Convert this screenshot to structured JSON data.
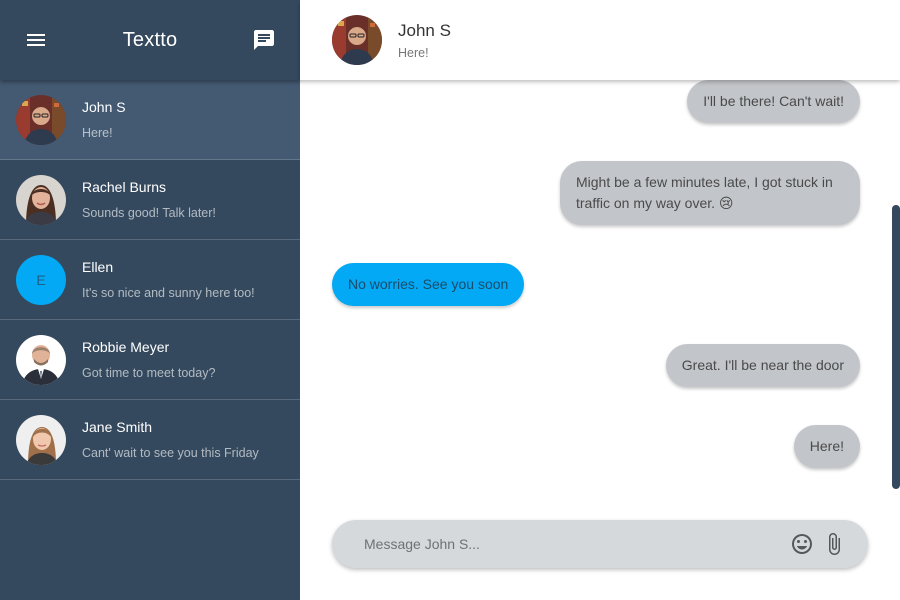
{
  "app": {
    "title": "Textto",
    "icons": {
      "menu": "menu-icon",
      "new_message": "chat-bubble-icon"
    },
    "colors": {
      "sidebar": "#34495e",
      "active_item": "#435a72",
      "accent": "#03a9f4",
      "incoming_bubble": "#c2c5c9"
    }
  },
  "conversations": [
    {
      "name": "John S",
      "preview": "Here!",
      "avatar": "photo",
      "active": true
    },
    {
      "name": "Rachel Burns",
      "preview": "Sounds good! Talk later!",
      "avatar": "photo",
      "active": false
    },
    {
      "name": "Ellen",
      "preview": "It's so nice and sunny here too!",
      "avatar": "E",
      "active": false
    },
    {
      "name": "Robbie Meyer",
      "preview": "Got time to meet today?",
      "avatar": "photo",
      "active": false
    },
    {
      "name": "Jane Smith",
      "preview": "Cant' wait to see you this Friday",
      "avatar": "photo",
      "active": false
    }
  ],
  "chat": {
    "contact_name": "John S",
    "contact_status": "Here!",
    "messages": [
      {
        "text": "I'll be there! Can't wait!",
        "direction": "in"
      },
      {
        "text": "Might be a few minutes late, I got stuck in traffic on my way over. 😢",
        "direction": "in"
      },
      {
        "text": "No worries. See you soon",
        "direction": "out"
      },
      {
        "text": "Great. I'll be near the door",
        "direction": "in"
      },
      {
        "text": "Here!",
        "direction": "in"
      }
    ],
    "composer": {
      "placeholder": "Message John S...",
      "value": "",
      "icons": {
        "emoji": "emoji-icon",
        "attach": "paperclip-icon"
      }
    }
  }
}
